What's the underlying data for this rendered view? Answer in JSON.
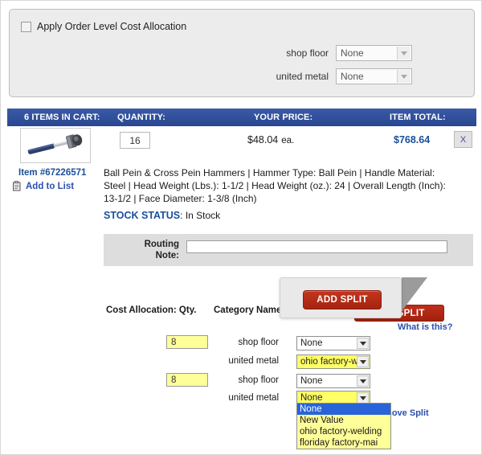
{
  "order_panel": {
    "checkbox_label": "Apply Order Level Cost Allocation",
    "checked": false,
    "fields": [
      {
        "label": "shop floor",
        "value": "None"
      },
      {
        "label": "united metal",
        "value": "None"
      }
    ]
  },
  "cart_header": {
    "items_in_cart": "6 ITEMS IN CART:",
    "quantity": "QUANTITY:",
    "your_price": "YOUR PRICE:",
    "item_total": "ITEM TOTAL:"
  },
  "cart_item": {
    "quantity_value": "16",
    "price": "$48.04",
    "price_unit": "ea.",
    "item_total": "$768.64",
    "remove_label": "X",
    "item_number": "Item #67226571",
    "add_to_list": "Add to List",
    "description": "Ball Pein & Cross Pein Hammers | Hammer Type: Ball Pein | Handle Material: Steel | Head Weight (Lbs.): 1-1/2 | Head Weight (oz.): 24 | Overall Length (Inch): 13-1/2 | Face Diameter: 1-3/8 (Inch)",
    "stock_label": "STOCK STATUS",
    "stock_separator": ": ",
    "stock_value": "In Stock"
  },
  "routing": {
    "label_line1": "Routing",
    "label_line2": "Note:",
    "value": "",
    "placeholder": ""
  },
  "cost_allocation": {
    "qty_heading": "Cost Allocation: Qty.",
    "category_heading": "Category Name:",
    "add_split_label": "ADD SPLIT",
    "add_split_tooltip_label": "ADD SPLIT",
    "what_is_this": "What is this?",
    "remove_split": "Remove Split",
    "splits": [
      {
        "qty": "8",
        "rows": [
          {
            "label": "shop floor",
            "value": "None",
            "highlight": false
          },
          {
            "label": "united metal",
            "value": "ohio factory-we",
            "highlight": true
          }
        ]
      },
      {
        "qty": "8",
        "rows": [
          {
            "label": "shop floor",
            "value": "None",
            "highlight": false
          },
          {
            "label": "united metal",
            "value": "None",
            "highlight": true
          }
        ]
      }
    ],
    "open_dropdown": {
      "selected_index": 0,
      "options": [
        "None",
        "New Value",
        "ohio factory-welding",
        "floriday factory-mai"
      ]
    }
  },
  "colors": {
    "header_blue": "#2d4f9e",
    "link_blue": "#2b4fae",
    "accent_red": "#a52411",
    "highlight_yellow": "#ffff66",
    "panel_gray": "#ececec",
    "select_highlight": "#2864d8"
  }
}
